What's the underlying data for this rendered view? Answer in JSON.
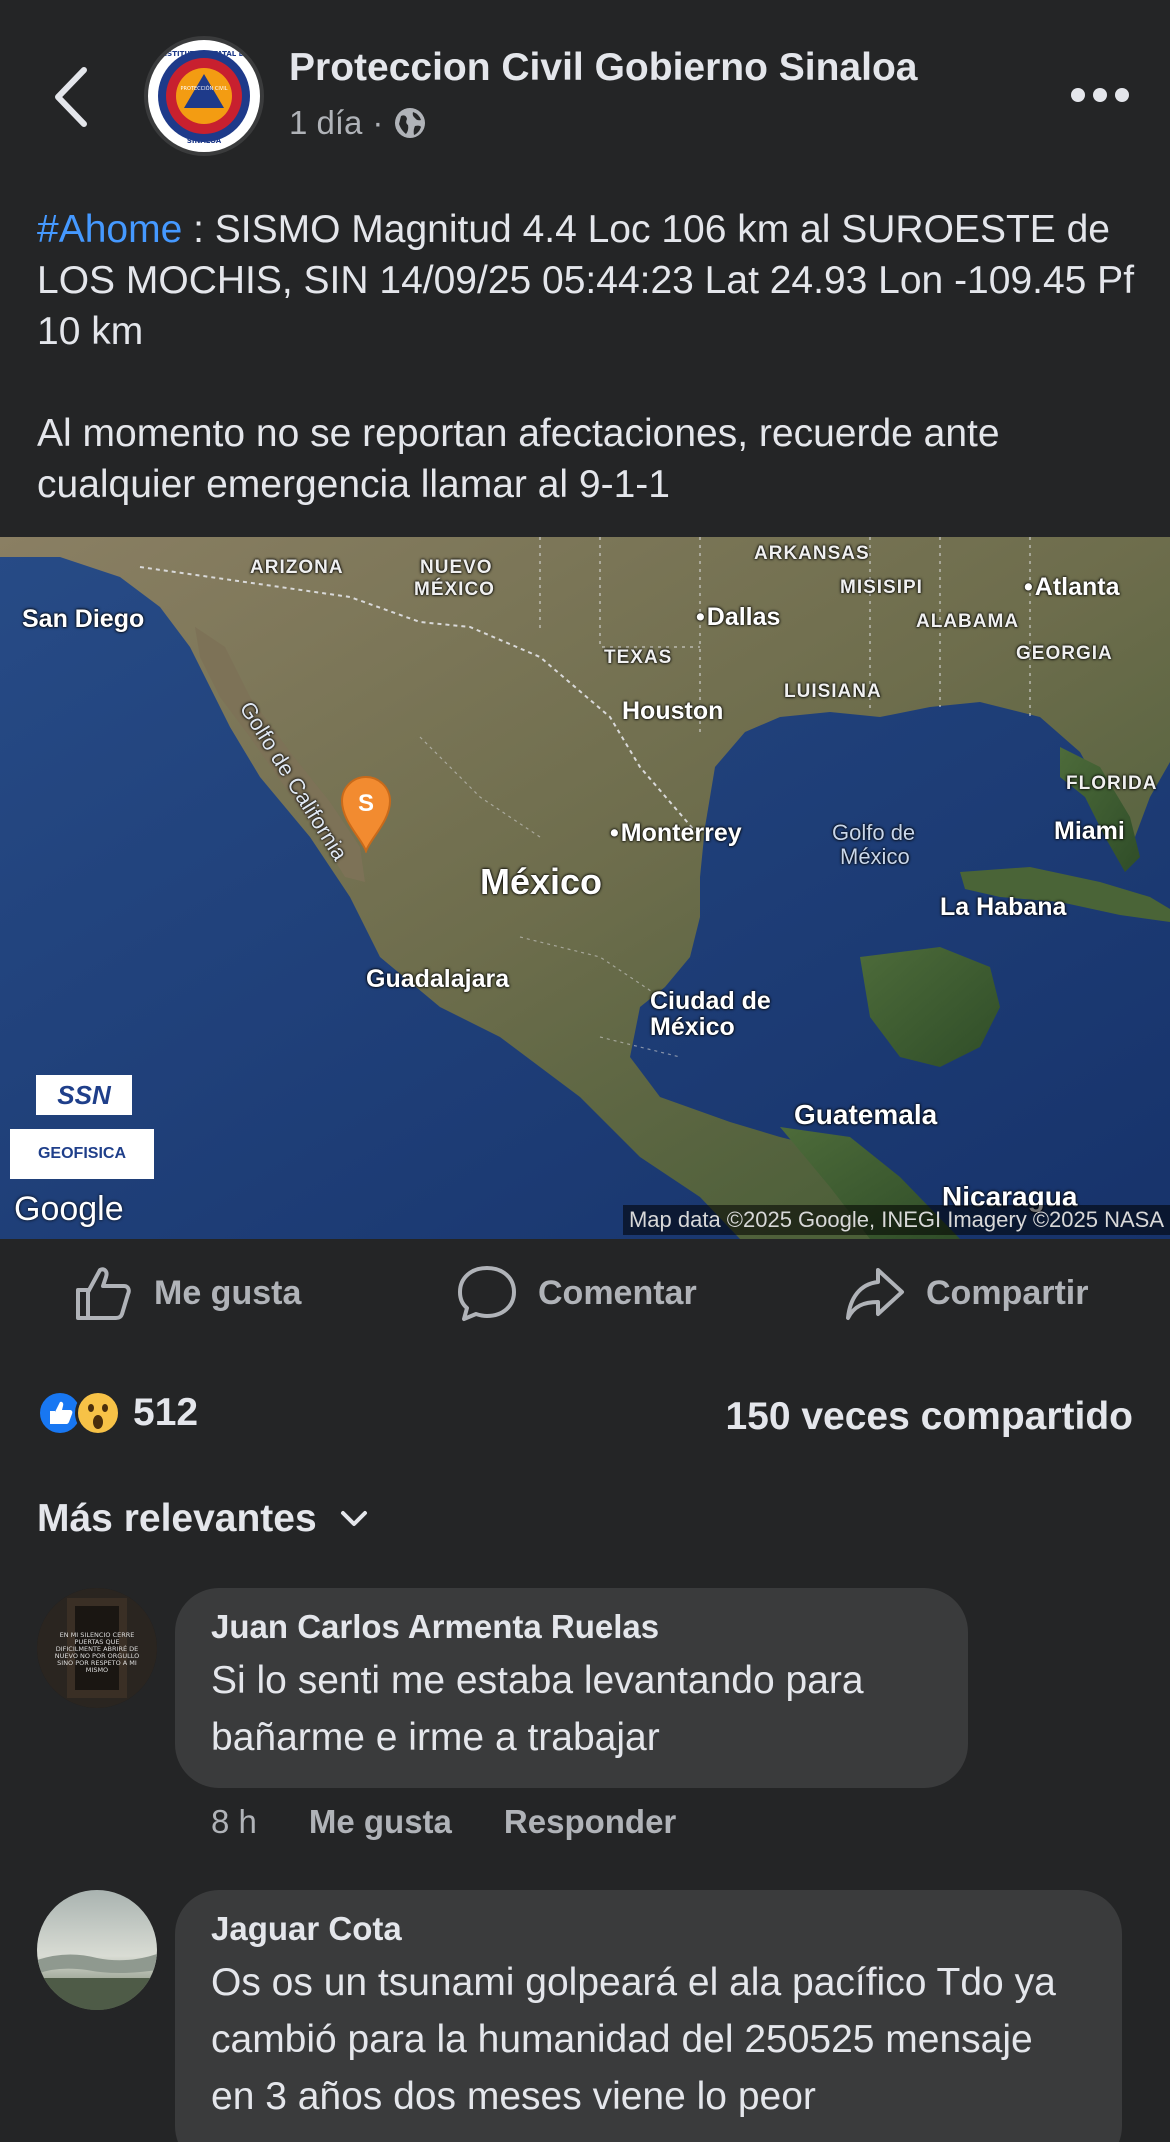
{
  "header": {
    "page_name": "Proteccion Civil Gobierno Sinaloa",
    "time": "1 día",
    "separator": "·",
    "privacy_icon": "globe-icon",
    "logo_text_top": "INSTITUTO ESTATAL DE",
    "logo_text_mid": "PROTECCIÓN CIVIL",
    "logo_text_bottom": "SINALOA"
  },
  "post": {
    "hashtag": "#Ahome",
    "line1_rest": " : SISMO Magnitud 4.4 Loc  106 km al SUROESTE de LOS MOCHIS, SIN 14/09/25 05:44:23 Lat 24.93 Lon -109.45 Pf 10 km",
    "paragraph2": "Al momento no se reportan afectaciones, recuerde ante cualquier emergencia llamar al 9-1-1"
  },
  "map": {
    "labels": {
      "arizona": "ARIZONA",
      "nuevo_mexico_1": "NUEVO",
      "nuevo_mexico_2": "MÉXICO",
      "arkansas": "ARKANSAS",
      "misisipi": "MISISIPI",
      "atlanta": "Atlanta",
      "san_diego": "San Diego",
      "dallas": "Dallas",
      "alabama": "ALABAMA",
      "texas": "TEXAS",
      "georgia": "GEORGIA",
      "luisiana": "LUISIANA",
      "houston": "Houston",
      "golfo_california": "Golfo de California",
      "florida": "FLORIDA",
      "monterrey": "Monterrey",
      "golfo_mexico_1": "Golfo de",
      "golfo_mexico_2": "México",
      "miami": "Miami",
      "mexico": "México",
      "la_habana": "La Habana",
      "guadalajara": "Guadalajara",
      "cdmx_1": "Ciudad de",
      "cdmx_2": "México",
      "guatemala": "Guatemala",
      "nicaragua": "Nicaragua"
    },
    "marker_letter": "S",
    "ssn_badge": "SSN",
    "geofisica_badge": "GEOFISICA",
    "google": "Google",
    "attribution": "Map data ©2025 Google, INEGI Imagery ©2025 NASA"
  },
  "actions": {
    "like": "Me gusta",
    "comment": "Comentar",
    "share": "Compartir"
  },
  "stats": {
    "reaction_count": "512",
    "shares": "150 veces compartido"
  },
  "sort_label": "Más relevantes",
  "comments": [
    {
      "author": "Juan Carlos Armenta Ruelas",
      "text": "Si lo senti me estaba levantando para bañarme e irme a trabajar",
      "time": "8 h",
      "like": "Me gusta",
      "reply": "Responder",
      "avatar_text": "EN MI SILENCIO CERRE PUERTAS QUE DIFICILMENTE ABRIRÉ DE NUEVO NO POR ORGULLO SINO POR RESPETO A MI MISMO"
    },
    {
      "author": "Jaguar Cota",
      "text": "Os os un tsunami golpeará el ala pacífico Tdo ya cambió para la humanidad del 250525 mensaje en 3 años dos meses viene lo peor"
    }
  ],
  "colors": {
    "background": "#242526",
    "bubble": "#3a3b3c",
    "text_primary": "#e4e6eb",
    "text_secondary": "#b0b3b8",
    "hashtag": "#4599ff",
    "marker": "#f28b30",
    "like_blue": "#1877f2",
    "wow_yellow": "#f7c247"
  }
}
